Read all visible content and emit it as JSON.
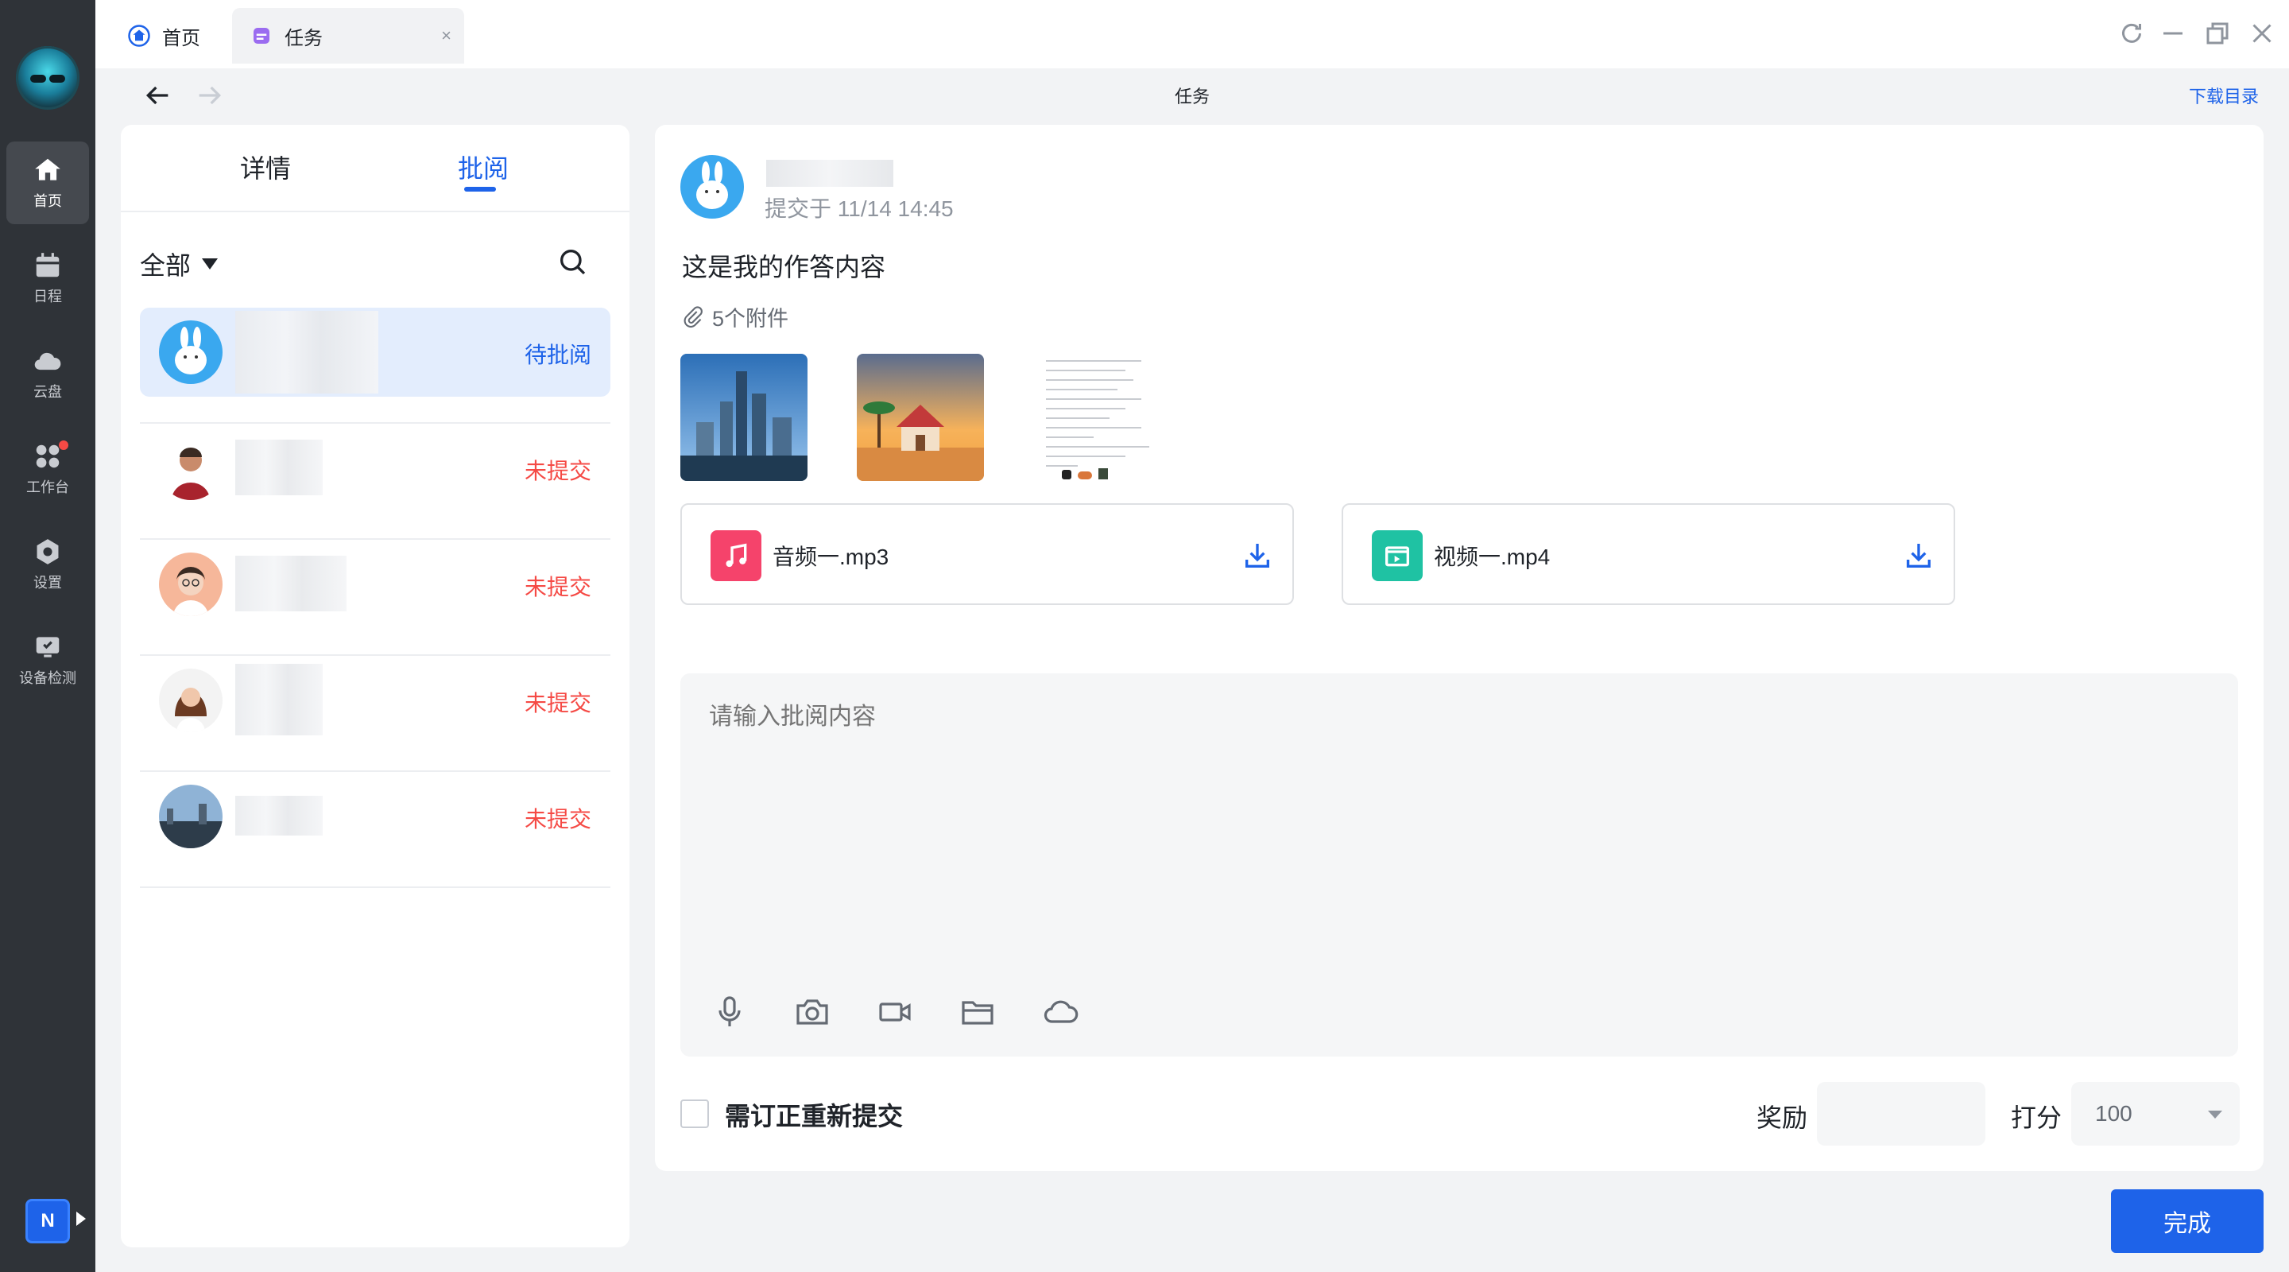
{
  "tabs": [
    {
      "label": "首页"
    },
    {
      "label": "任务",
      "close": "×"
    }
  ],
  "nav": {
    "title": "任务",
    "download_dir": "下载目录"
  },
  "rail": {
    "items": [
      {
        "label": "首页"
      },
      {
        "label": "日程"
      },
      {
        "label": "云盘"
      },
      {
        "label": "工作台"
      },
      {
        "label": "设置"
      },
      {
        "label": "设备检测"
      }
    ],
    "app_badge": "N"
  },
  "left_panel": {
    "tabs": [
      {
        "label": "详情"
      },
      {
        "label": "批阅"
      }
    ],
    "filter": "全部",
    "students": [
      {
        "status": "待批阅"
      },
      {
        "status": "未提交"
      },
      {
        "status": "未提交"
      },
      {
        "status": "未提交"
      },
      {
        "status": "未提交"
      }
    ],
    "colors": {
      "pending": "#1e63e9",
      "missing": "#f54a45"
    }
  },
  "submission": {
    "time": "提交于 11/14 14:45",
    "answer": "这是我的作答内容",
    "attachments_label": "5个附件",
    "files": [
      {
        "name": "音频一.mp3",
        "icon": "music-file-icon",
        "color": "#f5436b"
      },
      {
        "name": "视频一.mp4",
        "icon": "video-file-icon",
        "color": "#1fc2a3"
      }
    ]
  },
  "review": {
    "placeholder": "请输入批阅内容",
    "resubmit_label": "需订正重新提交",
    "reward_label": "奖励",
    "score_label": "打分",
    "score_value": "100",
    "done_label": "完成"
  }
}
